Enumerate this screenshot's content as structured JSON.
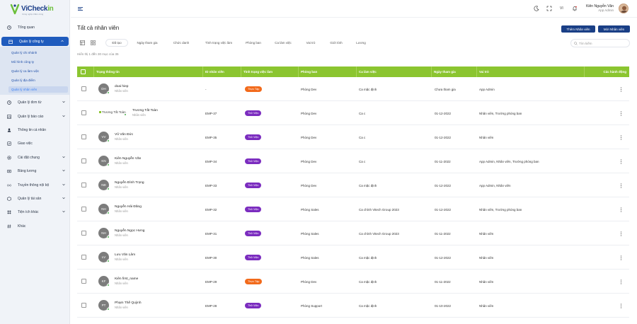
{
  "brand": {
    "name_a": "Vi",
    "name_b": "Check",
    "name_c": "in",
    "tagline": "Công nghệ chấm công"
  },
  "sidebar": {
    "items": [
      {
        "label": "Tổng quan",
        "icon": "clock-icon"
      },
      {
        "label": "Quản lý công ty",
        "icon": "building-icon",
        "active": true
      },
      {
        "label": "Quản lý đơn từ",
        "icon": "clock-icon"
      },
      {
        "label": "Quản lý báo cáo",
        "icon": "chart-icon"
      },
      {
        "label": "Thông tin cá nhân",
        "icon": "person-icon"
      },
      {
        "label": "Giao việc",
        "icon": "task-icon"
      },
      {
        "label": "Cài đặt chung",
        "icon": "gear-icon"
      },
      {
        "label": "Bảng lương",
        "icon": "money-icon"
      },
      {
        "label": "Truyền thông nội bộ",
        "icon": "broadcast-icon"
      },
      {
        "label": "Quản lý tài sản",
        "icon": "asset-icon"
      },
      {
        "label": "Tiện ích khác",
        "icon": "utility-icon"
      },
      {
        "label": "Khác",
        "icon": "hash-icon"
      }
    ],
    "submenu": [
      {
        "label": "Quản lý chi nhánh"
      },
      {
        "label": "Mô hình công ty"
      },
      {
        "label": "Quản lý ca làm việc"
      },
      {
        "label": "Quản lý địa điểm"
      },
      {
        "label": "Quản lý nhân viên",
        "current": true
      }
    ]
  },
  "header": {
    "language": "VI",
    "user_name": "Kiên Nguyễn Văn",
    "user_role": "App Admin"
  },
  "main": {
    "title": "Tất cả nhân viên",
    "add_button": "Thêm Nhân viên",
    "invite_button": "Mời Nhân viên",
    "filters": [
      "Đã tạo",
      "Ngày tham gia",
      "Chức danh",
      "Tình trạng việc làm",
      "Phòng ban",
      "Ca làm việc",
      "Vai trò",
      "Giới tính",
      "Lương"
    ],
    "search_placeholder": "Tìm kiếm",
    "count_text": "Hiển thị 1 đến 30 mục của 35"
  },
  "table": {
    "headers": [
      "Trạng thông tin",
      "ID nhân viên",
      "Tình trạng việc làm",
      "Phòng ban",
      "Ca làm việc",
      "Ngày tham gia",
      "Vai trò",
      "Các hành động"
    ],
    "rows": [
      {
        "initials": "DH",
        "name": "doai hiep",
        "position": "Nhân viên",
        "id": "-",
        "status": "Thực Tập",
        "status_type": "intern",
        "dept": "Phòng Dev",
        "shift": "Ca mặc định",
        "joined": "Chưa tham gia",
        "role": "App Admin"
      },
      {
        "initials": "",
        "broken_img": "Trương Tất Toàn",
        "name": "Trương Tất Toàn",
        "position": "Nhân viên",
        "id": "EMP-37",
        "status": "Thử Việc",
        "status_type": "trial",
        "dept": "Phòng Dev",
        "shift": "Ca c",
        "joined": "01-12-2022",
        "role": "Nhân viên, Trưởng phòng ban"
      },
      {
        "initials": "VV",
        "name": "Vũ Văn Đức",
        "position": "Nhân viên",
        "id": "EMP-35",
        "status": "Thử Việc",
        "status_type": "trial",
        "dept": "Phòng Dev",
        "shift": "Ca c",
        "joined": "01-12-2022",
        "role": "Nhân viên"
      },
      {
        "initials": "KN",
        "name": "Kiên Nguyễn Văn",
        "position": "Nhân viên",
        "id": "EMP-34",
        "status": "Thử Việc",
        "status_type": "trial",
        "dept": "Phòng Dev",
        "shift": "Ca c",
        "joined": "01-11-2022",
        "role": "App Admin, Nhân viên, Trưởng phòng ban"
      },
      {
        "initials": "NĐ",
        "name": "Nguyễn Đình Trọng",
        "position": "Nhân viên",
        "id": "EMP-33",
        "status": "Thử Việc",
        "status_type": "trial",
        "dept": "Phòng Dev",
        "shift": "Ca mặc định",
        "joined": "01-12-2022",
        "role": "App Admin, Nhân viên"
      },
      {
        "initials": "NH",
        "name": "Nguyễn Hải Đăng",
        "position": "Nhân viên",
        "id": "EMP-32",
        "status": "Thử Việc",
        "status_type": "trial",
        "dept": "Phòng Sales",
        "shift": "Ca chính Vitech Group 2023",
        "joined": "01-12-2022",
        "role": "Nhân viên, Trưởng phòng ban"
      },
      {
        "initials": "NH",
        "name": "Nguyễn Ngọc Hưng",
        "position": "Nhân viên",
        "id": "EMP-31",
        "status": "Thử Việc",
        "status_type": "trial",
        "dept": "Phòng Sales",
        "shift": "Ca chính Vitech Group 2023",
        "joined": "01-11-2022",
        "role": "Nhân viên"
      },
      {
        "initials": "LV",
        "name": "Lưu Văn Lâm",
        "position": "Nhân viên",
        "id": "EMP-30",
        "status": "Thử Việc",
        "status_type": "trial",
        "dept": "Phòng Sales",
        "shift": "Ca mặc định",
        "joined": "01-12-2022",
        "role": "Nhân viên"
      },
      {
        "initials": "KF",
        "name": "Kiên first_name",
        "position": "Nhân viên",
        "id": "EMP-29",
        "status": "Thực Tập",
        "status_type": "intern",
        "dept": "Phòng Dev",
        "shift": "Ca mặc định",
        "joined": "01-11-2022",
        "role": "Nhân viên"
      },
      {
        "initials": "PT",
        "name": "Phạm Thế Quỳnh",
        "position": "Nhân viên",
        "id": "EMP-28",
        "status": "Thử Việc",
        "status_type": "trial",
        "dept": "Phòng Support",
        "shift": "Ca mặc định",
        "joined": "01-10-2022",
        "role": "Nhân viên"
      }
    ]
  },
  "colors": {
    "primary": "#1a3f86",
    "table_header": "#8bc530",
    "trial": "#7b2cbf",
    "intern": "#f26a1b",
    "sidebar_active": "#1f5bbd"
  }
}
